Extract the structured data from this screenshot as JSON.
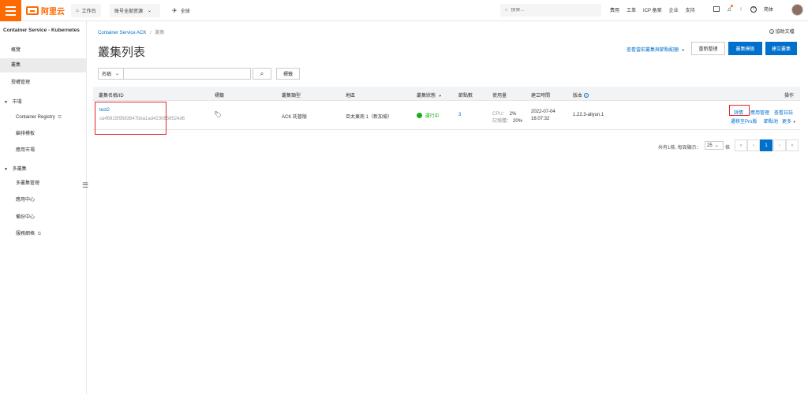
{
  "topbar": {
    "logo_text": "阿里云",
    "workbench": "工作台",
    "resources": "账号全部资源",
    "region": "全球",
    "search_placeholder": "搜索...",
    "links": [
      "费用",
      "工单",
      "ICP 备案",
      "企业",
      "支持"
    ],
    "lang": "简体"
  },
  "sidebar": {
    "title": "Container Service - Kubernetes",
    "items": [
      "概覽",
      "叢集",
      "授權管理"
    ],
    "group_market": "市場",
    "market_items": [
      "Container Registry",
      "編排模板",
      "應用市場"
    ],
    "group_multi": "多叢集",
    "multi_items": [
      "多叢集管理",
      "應用中心",
      "備份中心",
      "服務網格"
    ]
  },
  "breadcrumb": {
    "root": "Container Service ACK",
    "sep": "/",
    "current": "叢集"
  },
  "help_doc": "協助文檔",
  "page_title": "叢集列表",
  "view_link": "查看當前叢集與節點配額",
  "buttons": {
    "refresh": "重新整理",
    "template": "叢集模板",
    "create": "建立叢集"
  },
  "filter": {
    "field": "名稱",
    "tag": "標籤"
  },
  "table": {
    "headers": [
      "叢集名稱/ID",
      "標籤",
      "叢集類型",
      "地區",
      "叢集狀態",
      "節點數",
      "使用量",
      "建立時間",
      "版本",
      "操作"
    ],
    "row": {
      "name": "test2",
      "id": "ca46915f9583847bba1ad4230856524d6",
      "type": "ACK 託管版",
      "region": "亞太東南 1（新加坡）",
      "status": "運行中",
      "nodes": "3",
      "cpu_label": "CPU：",
      "cpu_value": "2%",
      "mem_label": "記憶體：",
      "mem_value": "20%",
      "created_date": "2022-07-04",
      "created_time": "16:07:32",
      "version": "1.22.3-aliyun.1",
      "actions_row1": [
        "詳情",
        "應用管理",
        "查看日誌"
      ],
      "actions_row2": [
        "遷移至Pro版",
        "節點池",
        "更多"
      ]
    }
  },
  "pager": {
    "summary": "共有1條, 每頁顯示：",
    "page_size": "25",
    "unit": "條",
    "current_page": "1"
  }
}
